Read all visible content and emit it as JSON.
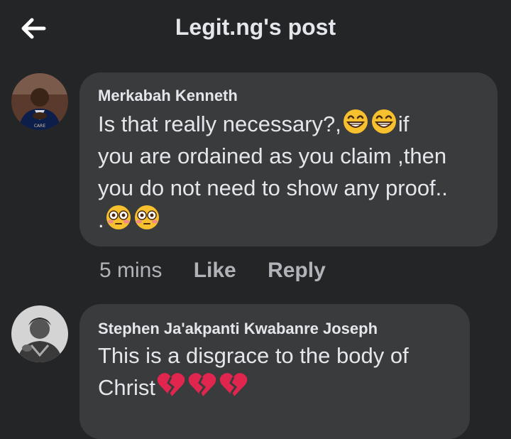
{
  "header": {
    "title": "Legit.ng's post",
    "back_icon": "arrow-left-icon"
  },
  "comments": [
    {
      "author": "Merkabah Kenneth",
      "text_l1": "Is that really necessary?,",
      "text_l1b": "if",
      "text_l2": "you are ordained as you claim ,then",
      "text_l3": "you do not need to show any proof..",
      "text_l4": ".",
      "emojis_l1": [
        "grinning-face-icon",
        "grinning-face-icon"
      ],
      "emojis_l4": [
        "flushed-face-icon",
        "flushed-face-icon"
      ],
      "time": "5 mins",
      "like_label": "Like",
      "reply_label": "Reply"
    },
    {
      "author": "Stephen Ja'akpanti Kwabanre Joseph",
      "text_l1": "This is a disgrace to the body of",
      "text_l2": "Christ",
      "emojis_l2": [
        "broken-heart-icon",
        "broken-heart-icon",
        "broken-heart-icon"
      ]
    }
  ],
  "colors": {
    "background": "#242526",
    "bubble": "#3a3b3c",
    "text": "#e4e6eb",
    "muted": "#b0b3b8",
    "emoji": "#f7c02e",
    "heart": "#e0264e"
  }
}
